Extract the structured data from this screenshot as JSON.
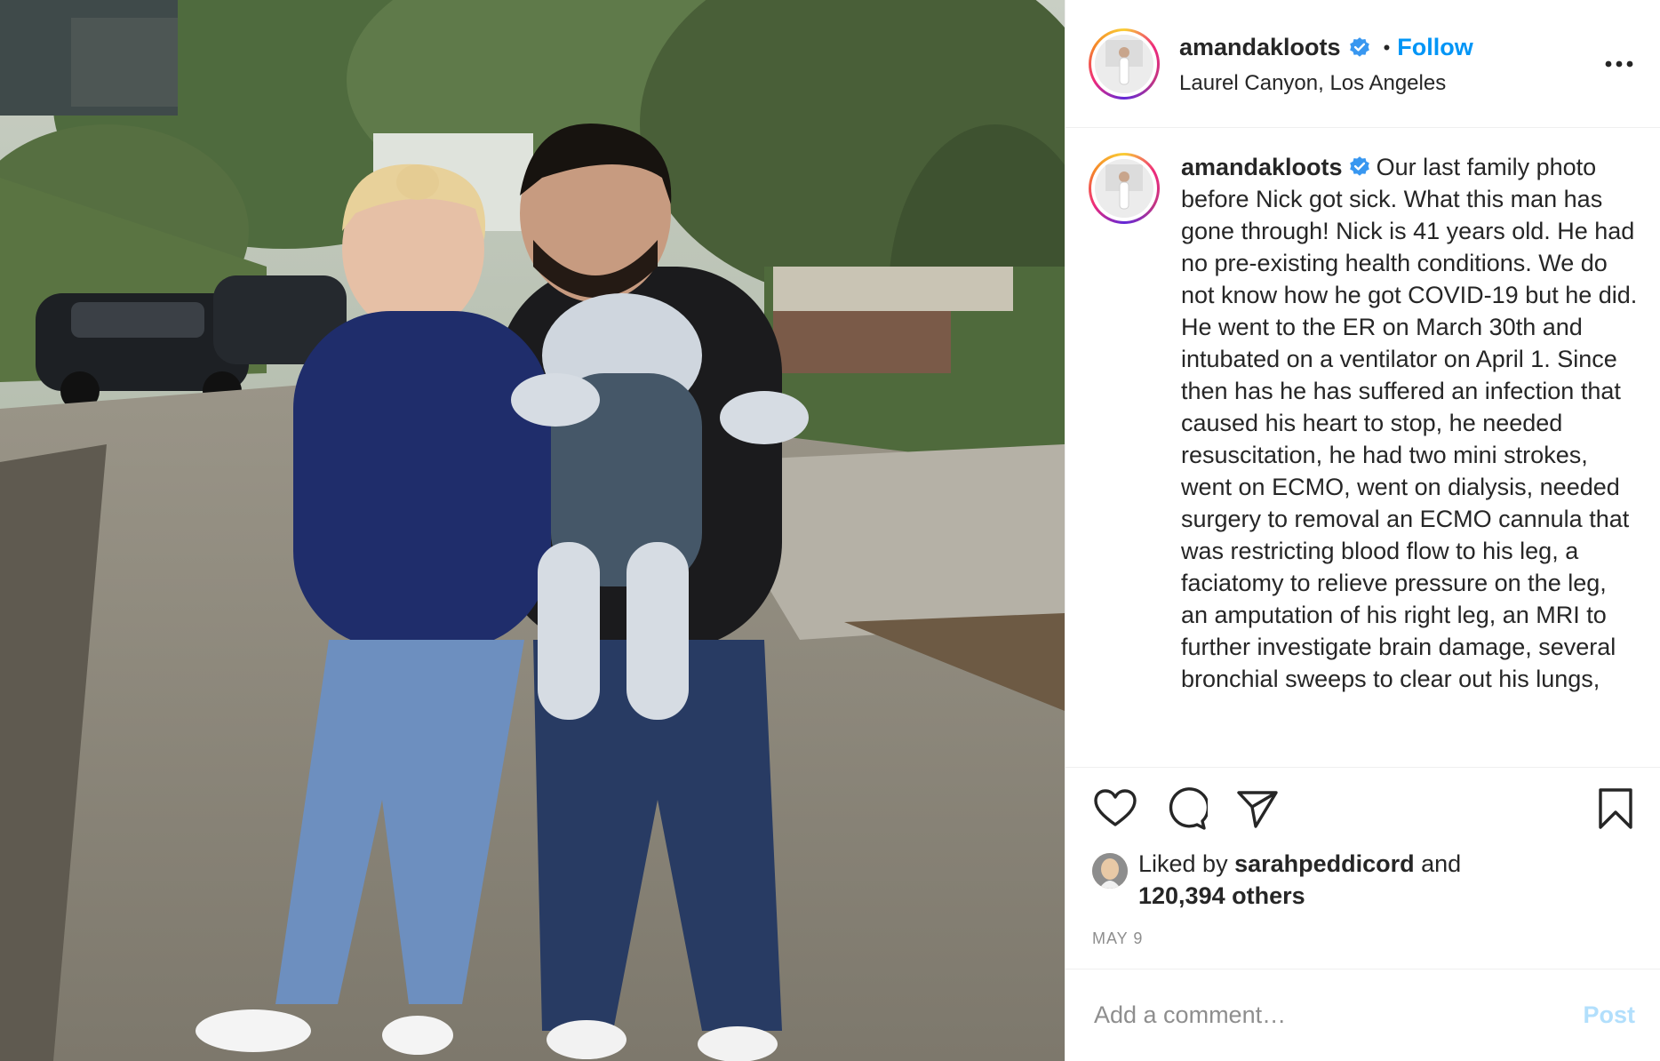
{
  "post": {
    "username": "amandakloots",
    "follow_label": "Follow",
    "separator": "•",
    "location": "Laurel Canyon, Los Angeles",
    "more_icon": "more-horizontal-icon"
  },
  "caption": {
    "username": "amandakloots",
    "text": "Our last family photo before Nick got sick. What this man has gone through! Nick is 41 years old. He had no pre-existing health conditions. We do not know how he got COVID-19 but he did. He went to the ER on March 30th and intubated on a ventilator on April 1. Since then has he has suffered an infection that caused his heart to stop, he needed resuscitation, he had two mini strokes, went on ECMO, went on dialysis, needed surgery to removal an ECMO cannula that was restricting blood flow to his leg, a faciatomy to relieve pressure on the leg, an amputation of his right leg, an MRI to further investigate brain damage, several bronchial sweeps to clear out his lungs,"
  },
  "actions": {
    "like_icon": "heart-icon",
    "comment_icon": "comment-icon",
    "share_icon": "share-icon",
    "save_icon": "bookmark-icon"
  },
  "likes": {
    "prefix": "Liked by ",
    "user": "sarahpeddicord",
    "connector": " and",
    "others": "120,394 others"
  },
  "date": "MAY 9",
  "comment": {
    "placeholder": "Add a comment…",
    "post_label": "Post"
  },
  "colors": {
    "accent": "#0095f6",
    "post_disabled": "#b2dffc",
    "verified": "#3897f0",
    "muted": "#8e8e8e"
  }
}
